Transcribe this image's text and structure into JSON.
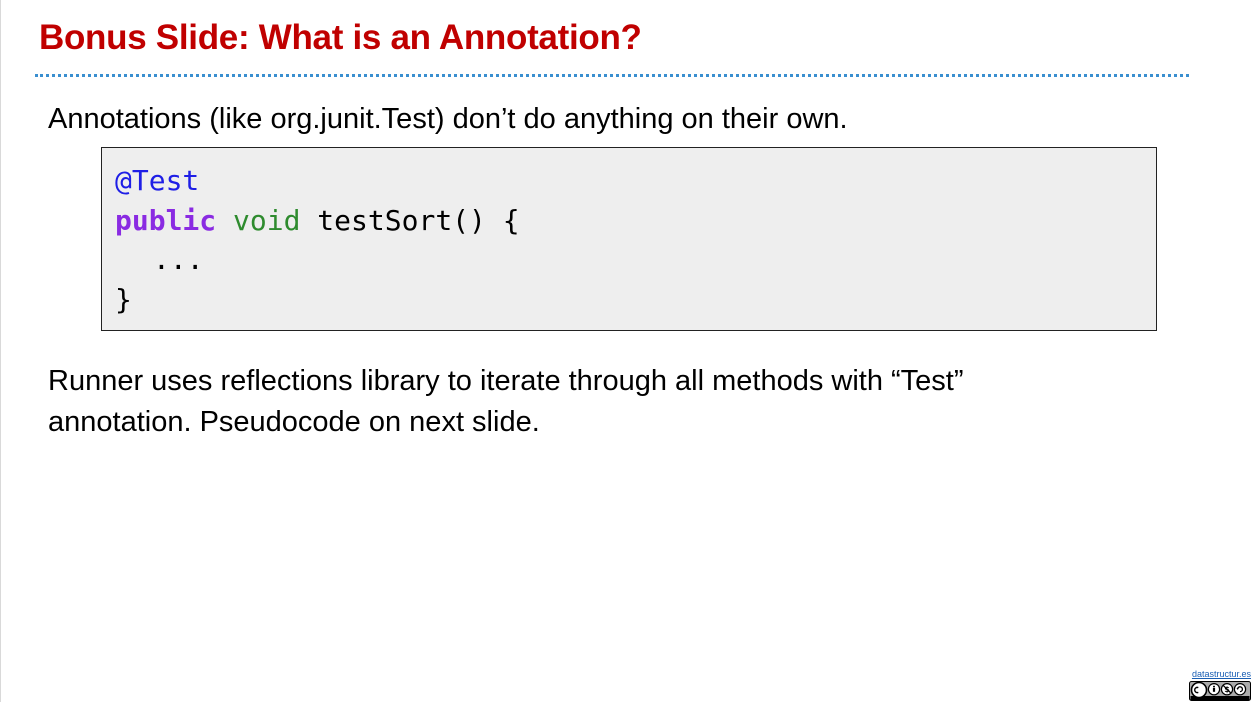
{
  "slide": {
    "title": "Bonus Slide: What is an Annotation?",
    "intro_text": "Annotations (like org.junit.Test) don’t do anything on their own.",
    "code": {
      "annotation": "@Test",
      "keyword_public": "public",
      "keyword_void": "void",
      "method_signature": " testSort() {",
      "body": "...",
      "closing_brace": "}"
    },
    "runner_text_line1": "Runner uses reflections library to iterate through all methods with “Test”",
    "runner_text_line2": "annotation. Pseudocode on next slide."
  },
  "footer": {
    "link_text": "datastructur.es",
    "license_icon": "creative-commons-by-nc-sa-icon"
  },
  "colors": {
    "title": "#c00000",
    "title_rule": "#3a8fd0",
    "code_background": "#eeeeee",
    "annotation_token": "#1e1ee6",
    "public_keyword": "#8a2be2",
    "void_keyword": "#2e8b2e"
  }
}
